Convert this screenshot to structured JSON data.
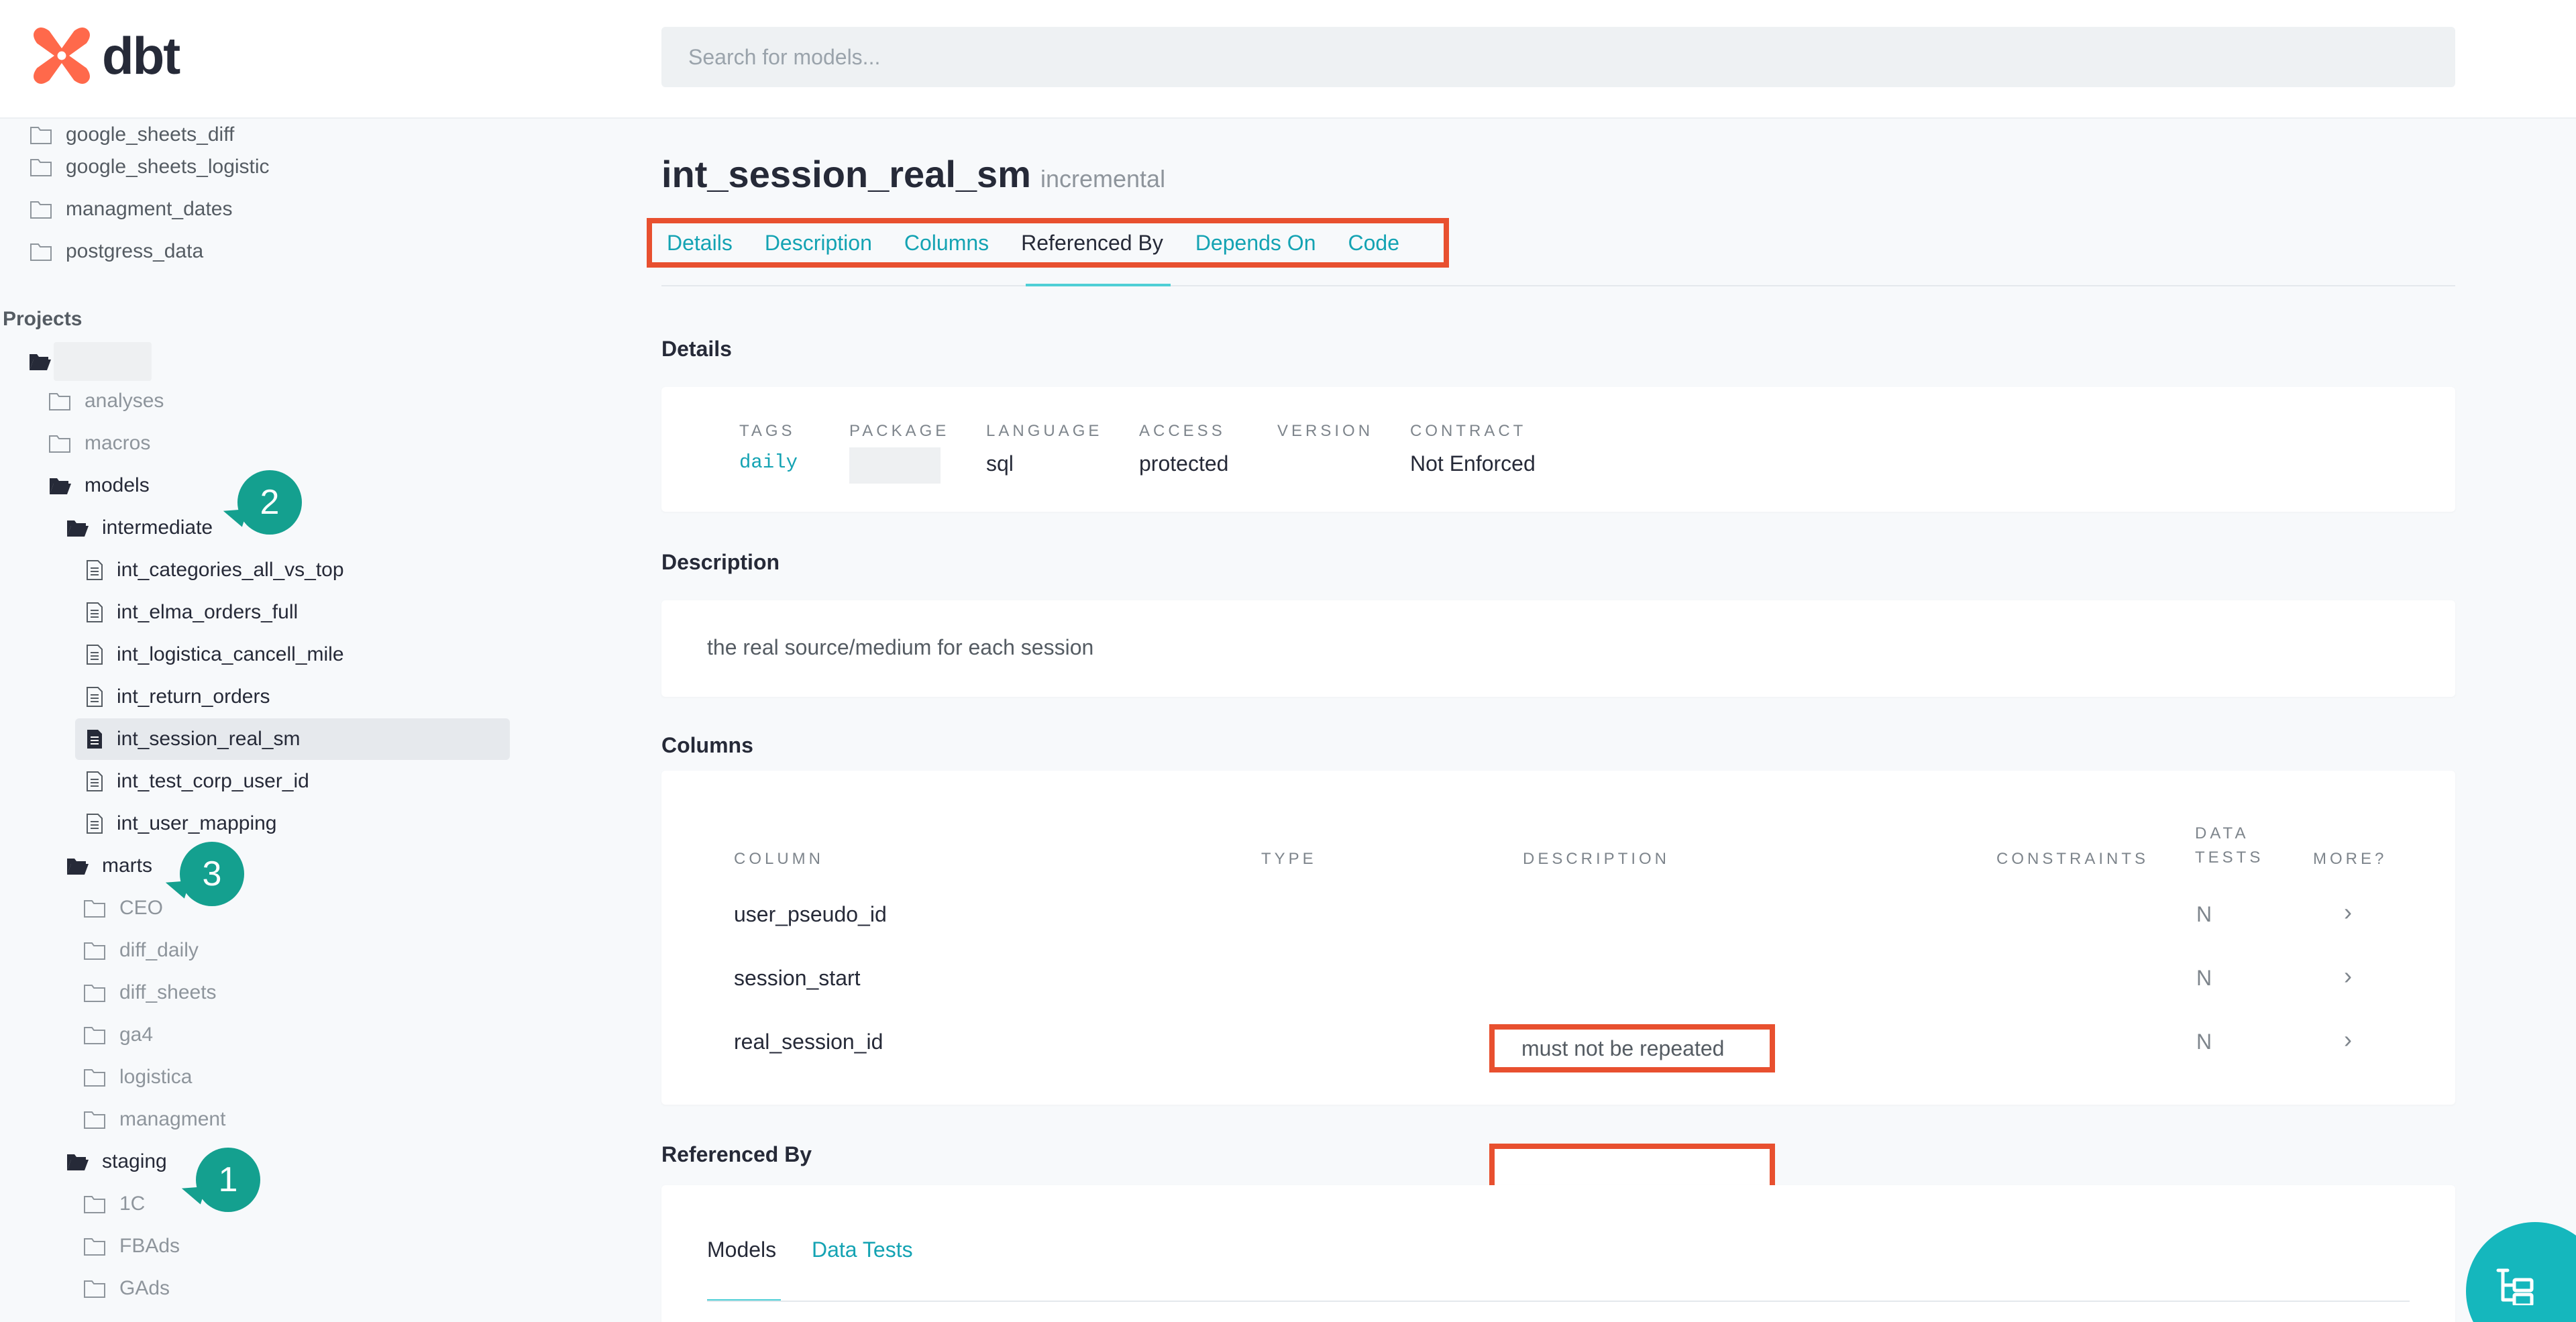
{
  "app": {
    "brand": "dbt",
    "accent": "#14a3b3",
    "brand_color": "#ff694b"
  },
  "search": {
    "placeholder": "Search for models..."
  },
  "sidebar": {
    "sources": [
      "google_sheets_diff",
      "google_sheets_logistic",
      "managment_dates",
      "postgress_data"
    ],
    "projects_label": "Projects",
    "project_folders": [
      "analyses",
      "macros"
    ],
    "models_folder": "models",
    "intermediate_folder": "intermediate",
    "intermediate_models": [
      "int_categories_all_vs_top",
      "int_elma_orders_full",
      "int_logistica_cancell_mile",
      "int_return_orders",
      "int_session_real_sm",
      "int_test_corp_user_id",
      "int_user_mapping"
    ],
    "marts_folder": "marts",
    "marts_subfolders": [
      "CEO",
      "diff_daily",
      "diff_sheets",
      "ga4",
      "logistica",
      "managment"
    ],
    "staging_folder": "staging",
    "staging_subfolders": [
      "1C",
      "FBAds",
      "GAds"
    ],
    "callouts": [
      "2",
      "3",
      "1"
    ]
  },
  "model": {
    "name": "int_session_real_sm",
    "materialization": "incremental",
    "tabs": [
      "Details",
      "Description",
      "Columns",
      "Referenced By",
      "Depends On",
      "Code"
    ],
    "active_tab": "Referenced By"
  },
  "details": {
    "title": "Details",
    "tags_label": "TAGS",
    "tags_value": "daily",
    "package_label": "PACKAGE",
    "language_label": "LANGUAGE",
    "language_value": "sql",
    "access_label": "ACCESS",
    "access_value": "protected",
    "version_label": "VERSION",
    "contract_label": "CONTRACT",
    "contract_value": "Not Enforced"
  },
  "description": {
    "title": "Description",
    "text": "the real source/medium for each session"
  },
  "columns": {
    "title": "Columns",
    "headers": [
      "COLUMN",
      "TYPE",
      "DESCRIPTION",
      "CONSTRAINTS",
      "DATA TESTS",
      "MORE?"
    ],
    "rows": [
      {
        "name": "user_pseudo_id",
        "description": "",
        "tests": "N"
      },
      {
        "name": "session_start",
        "description": "",
        "tests": "N"
      },
      {
        "name": "real_session_id",
        "description": "must not be repeated",
        "tests": "N"
      }
    ]
  },
  "referenced_by": {
    "title": "Referenced By",
    "tabs": [
      "Models",
      "Data Tests"
    ]
  }
}
